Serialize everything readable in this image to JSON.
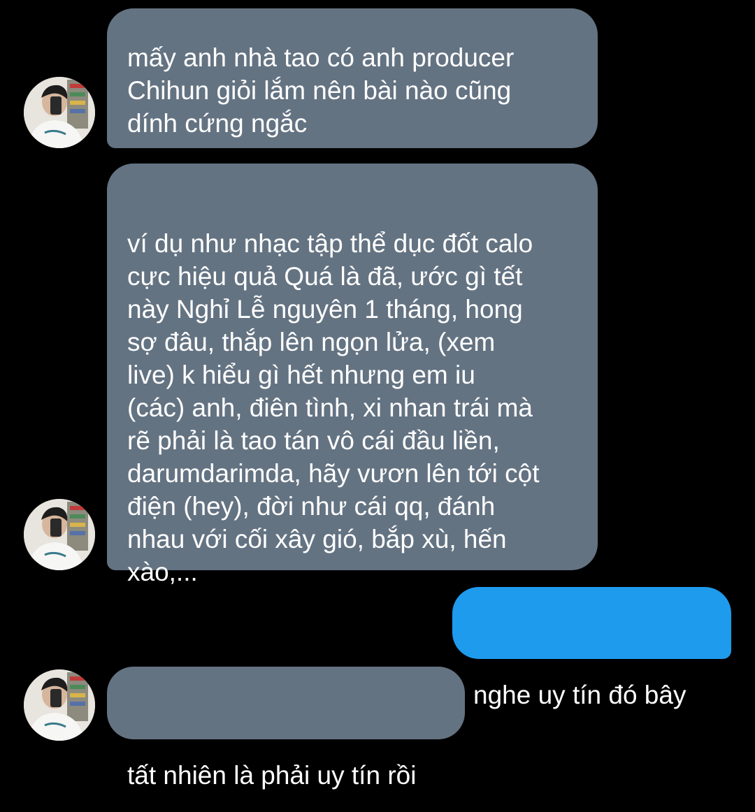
{
  "messages": [
    {
      "direction": "incoming",
      "text": "mấy anh nhà tao có anh producer\nChihun giỏi lắm nên bài nào cũng\ndính cứng ngắc"
    },
    {
      "direction": "incoming",
      "text": "ví dụ như nhạc tập thể dục đốt calo\ncực hiệu quả Quá là đã, ước gì tết\nnày Nghỉ Lễ nguyên 1 tháng, hong\nsợ đâu, thắp lên ngọn lửa, (xem\nlive) k hiểu gì hết nhưng em iu\n(các) anh, điên tình, xi nhan trái mà\nrẽ phải là tao tán vô cái đầu liền,\ndarumdarimda, hãy vươn lên tới cột\nđiện (hey), đời như cái qq, đánh\nnhau với cối xây gió, bắp xù, hến\nxào,..."
    },
    {
      "direction": "outgoing",
      "text": "nghe uy tín đó bây"
    },
    {
      "direction": "incoming",
      "text": "tất nhiên là phải uy tín rồi"
    }
  ],
  "colors": {
    "background": "#000000",
    "incoming_bubble": "#647382",
    "outgoing_bubble": "#1f9bed",
    "text": "#ffffff"
  },
  "icons": {
    "avatar": "contact-avatar-photo"
  }
}
